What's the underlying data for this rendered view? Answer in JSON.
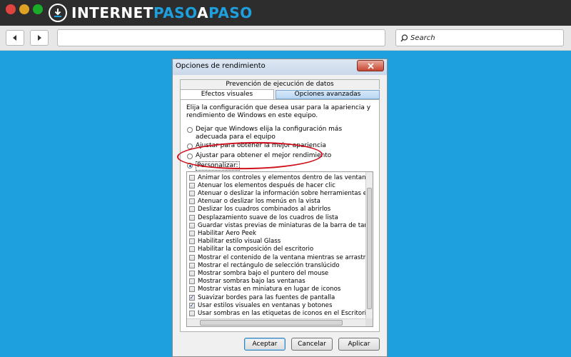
{
  "browser": {
    "logo": {
      "part1": "INTERNET",
      "part2": "PASO",
      "part3": "A",
      "part4": "PASO"
    },
    "search_placeholder": "Search",
    "colors": {
      "background": "#1ea0df",
      "titlebar": "#2d2d2d"
    }
  },
  "dialog": {
    "title": "Opciones de rendimiento",
    "tabs": {
      "data_execution": "Prevención de ejecución de datos",
      "visual_effects": "Efectos visuales",
      "advanced": "Opciones avanzadas"
    },
    "description": "Elija la configuración que desea usar para la apariencia y rendimiento de Windows en este equipo.",
    "radios": [
      {
        "label": "Dejar que Windows elija la configuración más adecuada para el equipo",
        "selected": false
      },
      {
        "label": "Ajustar para obtener la mejor apariencia",
        "selected": false
      },
      {
        "label": "Ajustar para obtener el mejor rendimiento",
        "selected": false
      },
      {
        "label": "Personalizar:",
        "selected": true
      }
    ],
    "effects": [
      {
        "label": "Animar los controles y elementos dentro de las ventanas",
        "checked": false
      },
      {
        "label": "Atenuar los elementos después de hacer clic",
        "checked": false
      },
      {
        "label": "Atenuar o deslizar la información sobre herramientas en la vista",
        "checked": false
      },
      {
        "label": "Atenuar o deslizar los menús en la vista",
        "checked": false
      },
      {
        "label": "Deslizar los cuadros combinados al abrirlos",
        "checked": false
      },
      {
        "label": "Desplazamiento suave de los cuadros de lista",
        "checked": false
      },
      {
        "label": "Guardar vistas previas de miniaturas de la barra de tareas",
        "checked": false
      },
      {
        "label": "Habilitar Aero Peek",
        "checked": false
      },
      {
        "label": "Habilitar estilo visual Glass",
        "checked": false
      },
      {
        "label": "Habilitar la composición del escritorio",
        "checked": false
      },
      {
        "label": "Mostrar el contenido de la ventana mientras se arrastra",
        "checked": false
      },
      {
        "label": "Mostrar el rectángulo de selección translúcido",
        "checked": false
      },
      {
        "label": "Mostrar sombra bajo el puntero del mouse",
        "checked": false
      },
      {
        "label": "Mostrar sombras bajo las ventanas",
        "checked": false
      },
      {
        "label": "Mostrar vistas en miniatura en lugar de iconos",
        "checked": false
      },
      {
        "label": "Suavizar bordes para las fuentes de pantalla",
        "checked": true
      },
      {
        "label": "Usar estilos visuales en ventanas y botones",
        "checked": true
      },
      {
        "label": "Usar sombras en las etiquetas de iconos en el Escritorio",
        "checked": false
      }
    ],
    "buttons": {
      "accept": "Aceptar",
      "cancel": "Cancelar",
      "apply": "Aplicar"
    },
    "highlight_color": "#d0101c"
  }
}
